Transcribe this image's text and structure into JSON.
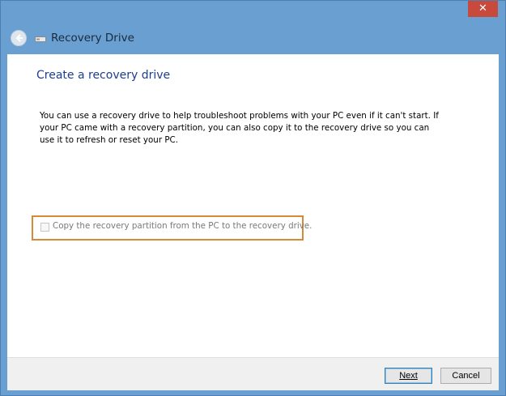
{
  "window": {
    "title": "Recovery Drive",
    "close_glyph": "✕",
    "icons": {
      "back": "back-arrow-icon",
      "drive": "drive-icon",
      "close": "close-icon"
    }
  },
  "page": {
    "heading": "Create a recovery drive",
    "description": "You can use a recovery drive to help troubleshoot problems with your PC even if it can't start. If your PC came with a recovery partition, you can also copy it to the recovery drive so you can use it to refresh or reset your PC.",
    "checkbox": {
      "label": "Copy the recovery partition from the PC to the recovery drive.",
      "checked": false,
      "enabled": false
    }
  },
  "footer": {
    "next_label": "Next",
    "cancel_label": "Cancel"
  },
  "colors": {
    "frame": "#6a9fd2",
    "close": "#c74a3d",
    "heading": "#1d3e8f",
    "highlight": "#d58a36"
  }
}
